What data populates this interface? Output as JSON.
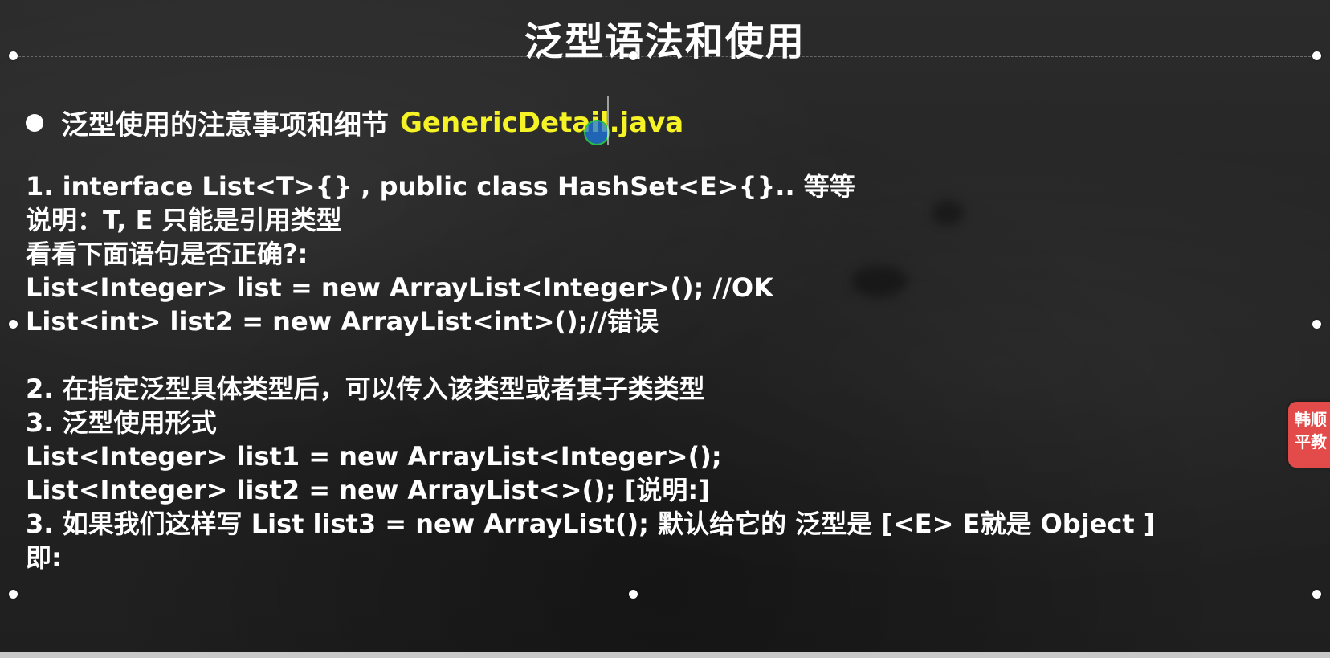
{
  "slide": {
    "title": "泛型语法和使用",
    "bullet": {
      "text": "泛型使用的注意事项和细节",
      "filename": "GenericDetail.java"
    },
    "lines": [
      "1.  interface List<T>{}  ,  public class HashSet<E>{}.. 等等",
      "说明：T, E 只能是引用类型",
      "看看下面语句是否正确?:",
      "List<Integer> list = new ArrayList<Integer>(); //OK",
      "List<int> list2 = new ArrayList<int>();//错误",
      "2.  在指定泛型具体类型后，可以传入该类型或者其子类类型",
      "3.  泛型使用形式",
      "List<Integer> list1 = new ArrayList<Integer>();",
      "List<Integer> list2 = new ArrayList<>(); [说明:]",
      "3.  如果我们这样写  List list3 = new ArrayList();  默认给它的 泛型是 [<E> E就是 Object ]",
      "即:"
    ]
  },
  "side_badge": {
    "text": "韩顺平教"
  },
  "colors": {
    "background": "#242424",
    "text": "#ffffff",
    "filename": "#f5f226",
    "badge": "#e34b4b"
  }
}
